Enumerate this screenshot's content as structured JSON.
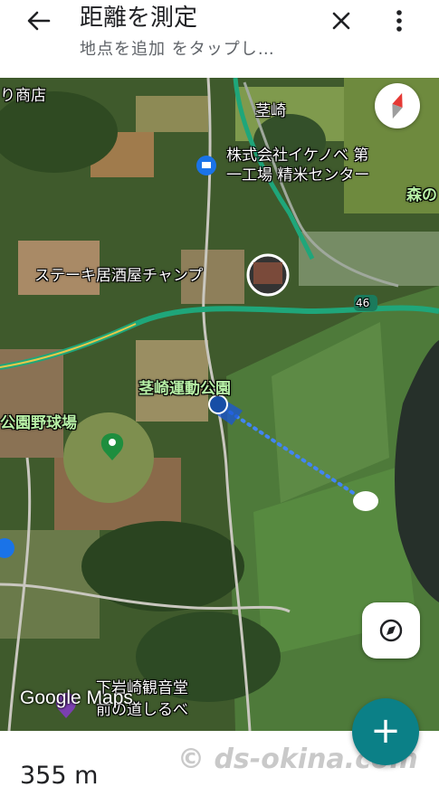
{
  "header": {
    "title": "距離を測定",
    "subtitle": "地点を追加 をタップし…"
  },
  "map": {
    "labels": {
      "shop_partial": "り商店",
      "area_kukizaki": "茎崎",
      "company_line1": "株式会社イケノベ 第",
      "company_line2": "一工場 精米センター",
      "forest_partial": "森の",
      "steak_house": "ステーキ居酒屋チャンプ",
      "route_number": "46",
      "sports_park": "茎崎運動公園",
      "baseball": "公園野球場",
      "kannondo_line1": "下岩崎観音堂",
      "kannondo_line2": "前の道しるべ"
    },
    "google_logo": "Google Maps"
  },
  "bottom": {
    "distance": "355 m",
    "watermark": "© ds-okina.com"
  },
  "icons": {
    "back": "back-arrow-icon",
    "close": "close-icon",
    "more": "more-vert-icon",
    "compass": "compass-icon",
    "location": "my-location-icon",
    "add": "add-icon"
  },
  "colors": {
    "fab": "#0b8087",
    "measure_line": "#4285f4",
    "highway": "#1fa67a"
  }
}
